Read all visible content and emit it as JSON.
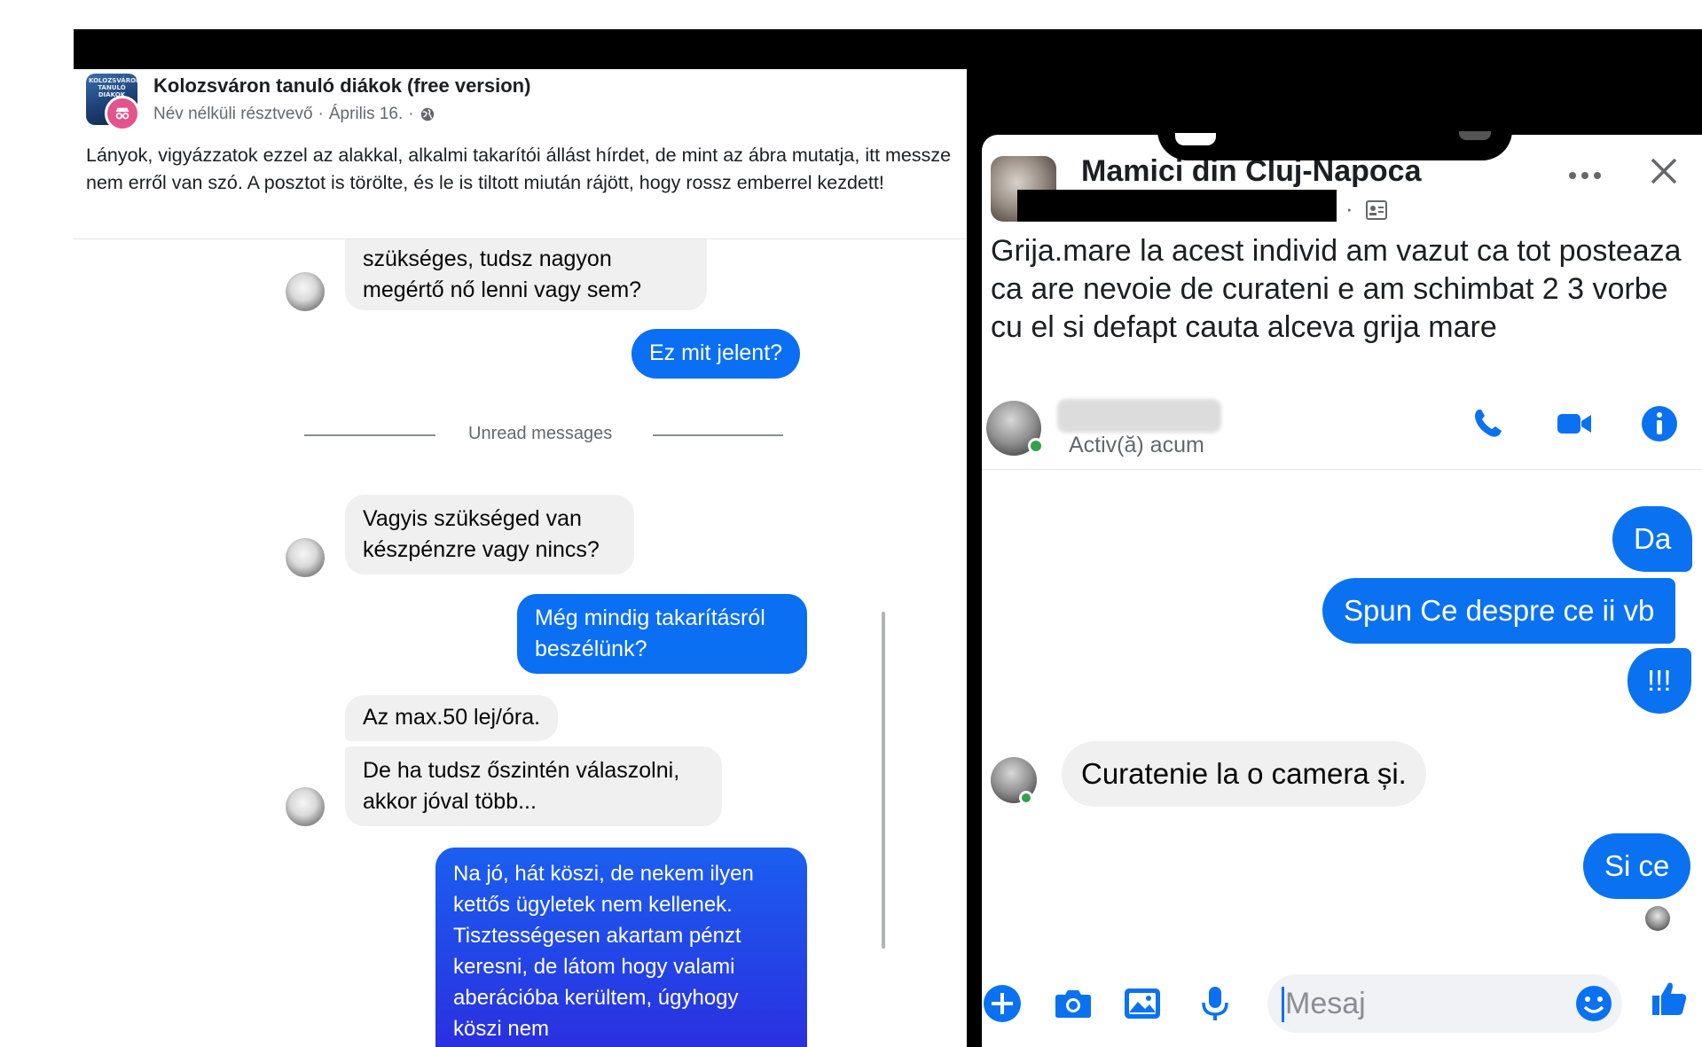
{
  "left_post": {
    "group_name": "Kolozsváron tanuló diákok (free version)",
    "author": "Név nélküli résztvevő",
    "separator": "·",
    "date": "Április 16.",
    "avatar_text": "KOLOZSVÁRON TANULÓ DIÁKOK",
    "text": "Lányok, vigyázzatok ezzel az alakkal, alkalmi takarítói állást hírdet, de mint az ábra mutatja, itt messze nem erről van szó. A posztot is törölte, és le is tiltott miután rájött, hogy rossz emberrel kezdett!"
  },
  "left_chat": {
    "msg1": "szükséges,  tudsz nagyon megértő nő lenni vagy sem?",
    "msg2": "Ez mit jelent?",
    "unread": "Unread messages",
    "msg3": "Vagyis szükséged van készpénzre vagy nincs?",
    "msg4": "Még mindig takarításról beszélünk?",
    "msg5": "Az max.50 lej/óra.",
    "msg6": "De ha tudsz őszintén válaszolni, akkor jóval több...",
    "msg7": "Na jó, hát köszi, de nekem ilyen kettős ügyletek nem kellenek. Tisztességesen akartam pénzt keresni, de látom hogy valami aberációba kerültem, úgyhogy köszi nem"
  },
  "right_post": {
    "group_name": "Mamici din Cluj-Napoca",
    "separator": "·",
    "text": "Grija.mare la acest individ am vazut ca tot posteaza  ca are nevoie de curateni e am schimbat 2 3 vorbe cu el si defapt cauta alceva grija mare"
  },
  "right_chat": {
    "status": "Activ(ă) acum",
    "msg1": "Da",
    "msg2": "Spun Ce despre ce ii vb",
    "msg3": "!!!",
    "msg4": "Curatenie la o camera și.",
    "msg5": "Si ce",
    "input_placeholder": "Mesaj"
  },
  "colors": {
    "messenger_blue": "#0a72f0",
    "anon_badge": "#e4548c",
    "online_green": "#31a24c"
  },
  "icons": [
    "globe-icon",
    "anonymous-icon",
    "more-icon",
    "close-icon",
    "contact-icon",
    "phone-icon",
    "video-icon",
    "info-icon",
    "plus-icon",
    "camera-icon",
    "image-icon",
    "microphone-icon",
    "emoji-icon",
    "like-icon"
  ]
}
